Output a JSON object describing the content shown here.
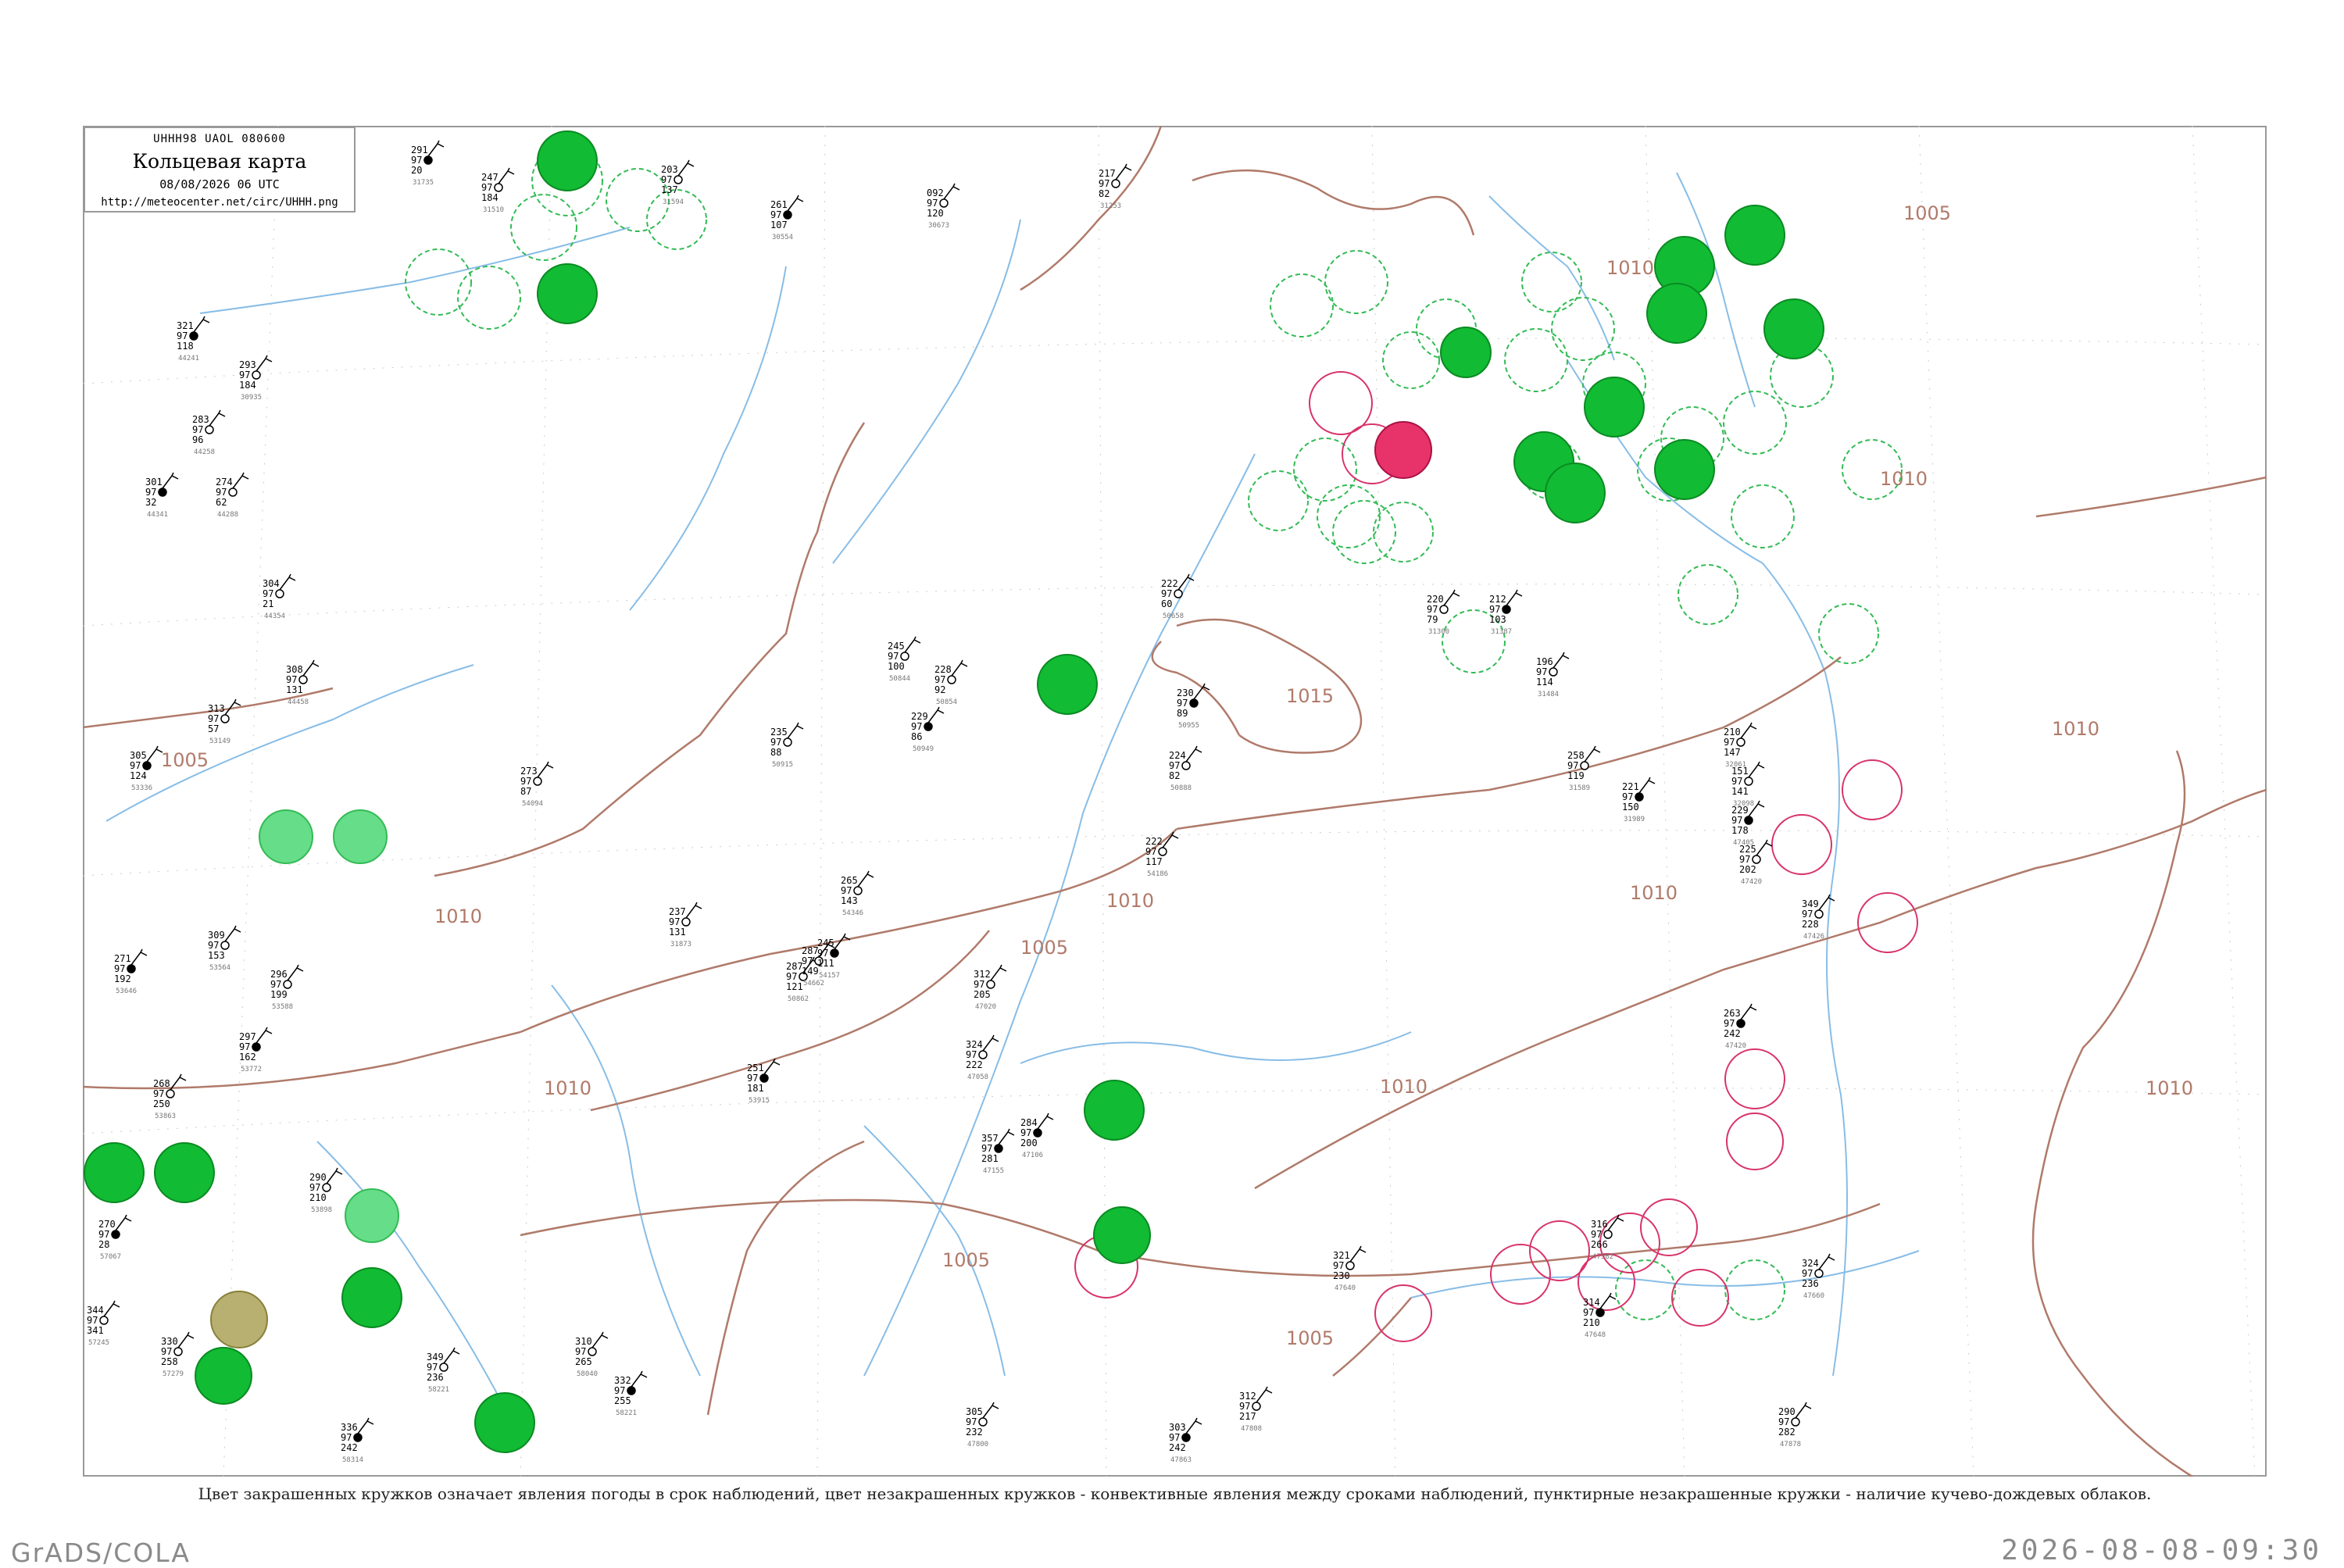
{
  "header": {
    "code": "UHHH98  UAOL  080600",
    "title": "Кольцевая карта",
    "date": "08/08/2026 06 UTC",
    "url": "http://meteocenter.net/circ/UHHH.png"
  },
  "caption": "Цвет закрашенных кружков означает явления погоды в срок наблюдений, цвет незакрашенных кружков - конвективные явления между сроками наблюдений, пунктирные незакрашенные кружки - наличие кучево-дождевых облаков.",
  "footer": {
    "left": "GrADS/COLA",
    "right": "2026-08-08-09:30"
  },
  "colors": {
    "frame": "#999999",
    "isobar": "#b07a6a",
    "river": "#88bde6",
    "rain_fill": "#11bb33",
    "light_rain_fill": "#66dd88",
    "thunder_fill": "#e8336a",
    "fog_fill": "#b8b070",
    "cb_ring": "#33bb55",
    "storm_ring": "#d8336a"
  },
  "isobars": [
    "1005",
    "1010",
    "1015"
  ],
  "stations": [
    {
      "lat": "291",
      "v1": "97",
      "v2": "20",
      "id": "31735"
    },
    {
      "lat": "247",
      "v1": "97",
      "v2": "184",
      "id": "31510"
    },
    {
      "lat": "203",
      "v1": "97",
      "v2": "137",
      "id": "31594"
    },
    {
      "lat": "261",
      "v1": "97",
      "v2": "107",
      "id": "30554"
    },
    {
      "lat": "092",
      "v1": "97",
      "v2": "120",
      "id": "30673"
    },
    {
      "lat": "217",
      "v1": "97",
      "v2": "82",
      "id": "31253"
    },
    {
      "lat": "321",
      "v1": "97",
      "v2": "118",
      "id": "44241"
    },
    {
      "lat": "293",
      "v1": "97",
      "v2": "184",
      "id": "30935"
    },
    {
      "lat": "283",
      "v1": "97",
      "v2": "96",
      "id": "44258"
    },
    {
      "lat": "301",
      "v1": "97",
      "v2": "32",
      "id": "44341"
    },
    {
      "lat": "274",
      "v1": "97",
      "v2": "62",
      "id": "44288"
    },
    {
      "lat": "304",
      "v1": "97",
      "v2": "21",
      "id": "44354"
    },
    {
      "lat": "305",
      "v1": "97",
      "v2": "124",
      "id": "53336"
    },
    {
      "lat": "313",
      "v1": "97",
      "v2": "57",
      "id": "53149"
    },
    {
      "lat": "308",
      "v1": "97",
      "v2": "131",
      "id": "44458"
    },
    {
      "lat": "271",
      "v1": "97",
      "v2": "192",
      "id": "53646"
    },
    {
      "lat": "309",
      "v1": "97",
      "v2": "153",
      "id": "53564"
    },
    {
      "lat": "296",
      "v1": "97",
      "v2": "199",
      "id": "53588"
    },
    {
      "lat": "297",
      "v1": "97",
      "v2": "162",
      "id": "53772"
    },
    {
      "lat": "268",
      "v1": "97",
      "v2": "250",
      "id": "53863"
    },
    {
      "lat": "290",
      "v1": "97",
      "v2": "210",
      "id": "53898"
    },
    {
      "lat": "270",
      "v1": "97",
      "v2": "28",
      "id": "57067"
    },
    {
      "lat": "344",
      "v1": "97",
      "v2": "341",
      "id": "57245"
    },
    {
      "lat": "330",
      "v1": "97",
      "v2": "258",
      "id": "57279"
    },
    {
      "lat": "336",
      "v1": "97",
      "v2": "242",
      "id": "58314"
    },
    {
      "lat": "349",
      "v1": "97",
      "v2": "236",
      "id": "58221"
    },
    {
      "lat": "310",
      "v1": "97",
      "v2": "265",
      "id": "58040"
    },
    {
      "lat": "332",
      "v1": "97",
      "v2": "255",
      "id": "58221"
    },
    {
      "lat": "245",
      "v1": "97",
      "v2": "100",
      "id": "50844"
    },
    {
      "lat": "228",
      "v1": "97",
      "v2": "92",
      "id": "50854"
    },
    {
      "lat": "229",
      "v1": "97",
      "v2": "86",
      "id": "50949"
    },
    {
      "lat": "222",
      "v1": "97",
      "v2": "60",
      "id": "50658"
    },
    {
      "lat": "224",
      "v1": "97",
      "v2": "82",
      "id": "50888"
    },
    {
      "lat": "230",
      "v1": "97",
      "v2": "89",
      "id": "50955"
    },
    {
      "lat": "235",
      "v1": "97",
      "v2": "88",
      "id": "50915"
    },
    {
      "lat": "220",
      "v1": "97",
      "v2": "79",
      "id": "31300"
    },
    {
      "lat": "212",
      "v1": "97",
      "v2": "103",
      "id": "31387"
    },
    {
      "lat": "196",
      "v1": "97",
      "v2": "114",
      "id": "31484"
    },
    {
      "lat": "258",
      "v1": "97",
      "v2": "119",
      "id": "31589"
    },
    {
      "lat": "221",
      "v1": "97",
      "v2": "150",
      "id": "31989"
    },
    {
      "lat": "210",
      "v1": "97",
      "v2": "147",
      "id": "32061"
    },
    {
      "lat": "151",
      "v1": "97",
      "v2": "141",
      "id": "32098"
    },
    {
      "lat": "229",
      "v1": "97",
      "v2": "178",
      "id": "47405"
    },
    {
      "lat": "225",
      "v1": "97",
      "v2": "202",
      "id": "47420"
    },
    {
      "lat": "349",
      "v1": "97",
      "v2": "228",
      "id": "47426"
    },
    {
      "lat": "263",
      "v1": "97",
      "v2": "242",
      "id": "47420"
    },
    {
      "lat": "324",
      "v1": "97",
      "v2": "236",
      "id": "47660"
    },
    {
      "lat": "316",
      "v1": "97",
      "v2": "266",
      "id": "47582"
    },
    {
      "lat": "314",
      "v1": "97",
      "v2": "210",
      "id": "47648"
    },
    {
      "lat": "290",
      "v1": "97",
      "v2": "282",
      "id": "47878"
    },
    {
      "lat": "321",
      "v1": "97",
      "v2": "230",
      "id": "47640"
    },
    {
      "lat": "303",
      "v1": "97",
      "v2": "242",
      "id": "47863"
    },
    {
      "lat": "312",
      "v1": "97",
      "v2": "217",
      "id": "47808"
    },
    {
      "lat": "305",
      "v1": "97",
      "v2": "232",
      "id": "47800"
    },
    {
      "lat": "357",
      "v1": "97",
      "v2": "281",
      "id": "47155"
    },
    {
      "lat": "324",
      "v1": "97",
      "v2": "222",
      "id": "47058"
    },
    {
      "lat": "312",
      "v1": "97",
      "v2": "205",
      "id": "47020"
    },
    {
      "lat": "284",
      "v1": "97",
      "v2": "200",
      "id": "47106"
    },
    {
      "lat": "287",
      "v1": "97",
      "v2": "121",
      "id": "50862"
    },
    {
      "lat": "273",
      "v1": "97",
      "v2": "87",
      "id": "54094"
    },
    {
      "lat": "251",
      "v1": "97",
      "v2": "181",
      "id": "53915"
    },
    {
      "lat": "287",
      "v1": "97",
      "v2": "149",
      "id": "54662"
    },
    {
      "lat": "265",
      "v1": "97",
      "v2": "143",
      "id": "54346"
    },
    {
      "lat": "245",
      "v1": "97",
      "v2": "111",
      "id": "54157"
    },
    {
      "lat": "222",
      "v1": "97",
      "v2": "117",
      "id": "54186"
    },
    {
      "lat": "237",
      "v1": "97",
      "v2": "131",
      "id": "31873"
    }
  ]
}
